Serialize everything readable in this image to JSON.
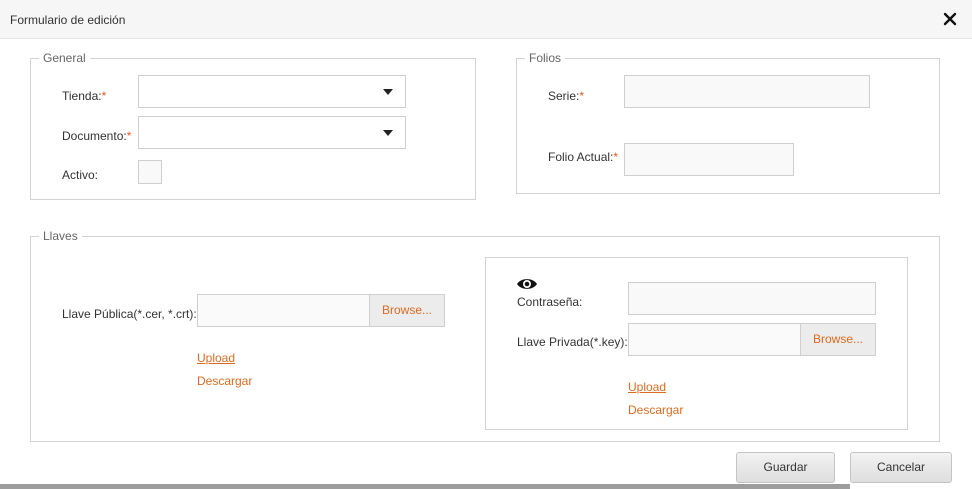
{
  "dialog": {
    "title": "Formulario de edición"
  },
  "general": {
    "legend": "General",
    "tienda_label": "Tienda:",
    "documento_label": "Documento:",
    "activo_label": "Activo:",
    "required_mark": "*"
  },
  "folios": {
    "legend": "Folios",
    "serie_label": "Serie:",
    "folio_actual_label": "Folio Actual:",
    "required_mark": "*"
  },
  "llaves": {
    "legend": "Llaves",
    "publica_label": "Llave Pública(*.cer, *.crt):",
    "browse_label": "Browse...",
    "upload_label": "Upload",
    "descargar_label": "Descargar",
    "contrasena_label": "Contraseña:",
    "privada_label": "Llave Privada(*.key):",
    "eye_icon": "eye-icon"
  },
  "footer": {
    "guardar_label": "Guardar",
    "cancelar_label": "Cancelar"
  },
  "colors": {
    "accent": "#e06b1e",
    "required": "#e05a1e"
  }
}
